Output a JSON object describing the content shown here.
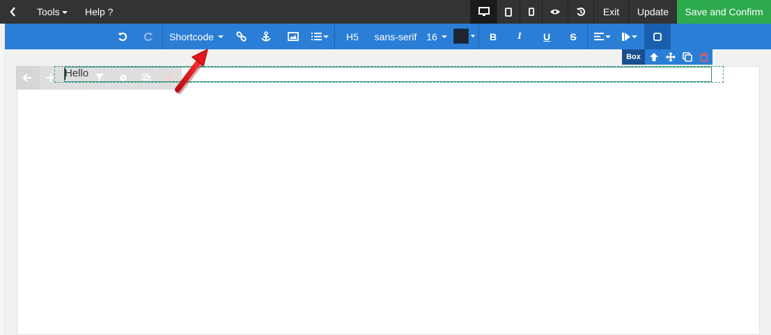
{
  "topbar": {
    "tools_label": "Tools",
    "help_label": "Help ?",
    "exit_label": "Exit",
    "update_label": "Update",
    "save_label": "Save and Confirm"
  },
  "toolbar": {
    "shortcode_label": "Shortcode",
    "heading_label": "H5",
    "font_label": "sans-serif",
    "size_label": "16",
    "bold_label": "B",
    "italic_label": "I",
    "underline_label": "U",
    "strike_label": "S",
    "text_color": "#1f2430"
  },
  "element_toolbar": {
    "label": "Box"
  },
  "canvas": {
    "text": "Hello"
  },
  "colors": {
    "topbar": "#333333",
    "toolbar": "#2b7ed6",
    "save": "#2eaa4e",
    "arrow": "#e0161b"
  }
}
